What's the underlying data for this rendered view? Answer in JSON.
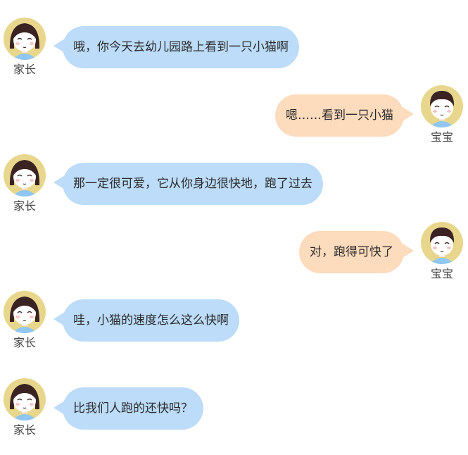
{
  "messages": [
    {
      "speaker": "家长",
      "text": "哦，你今天去幼儿园路上看到一只小猫啊"
    },
    {
      "speaker": "宝宝",
      "text": "嗯……看到一只小猫"
    },
    {
      "speaker": "家长",
      "text": "那一定很可爱，它从你身边很快地，跑了过去"
    },
    {
      "speaker": "宝宝",
      "text": "对，跑得可快了"
    },
    {
      "speaker": "家长",
      "text": "哇，小猫的速度怎么这么快啊"
    },
    {
      "speaker": "家长",
      "text": "比我们人跑的还快吗？"
    }
  ],
  "colors": {
    "parent_bubble": "#bcdcf9",
    "child_bubble": "#fddbbd",
    "avatar_ring": "#e8d68c",
    "hair": "#3a2322",
    "shirt": "#8fc7f2"
  },
  "icons": {
    "parent_avatar": "girl-avatar-icon",
    "child_avatar": "boy-avatar-icon"
  }
}
